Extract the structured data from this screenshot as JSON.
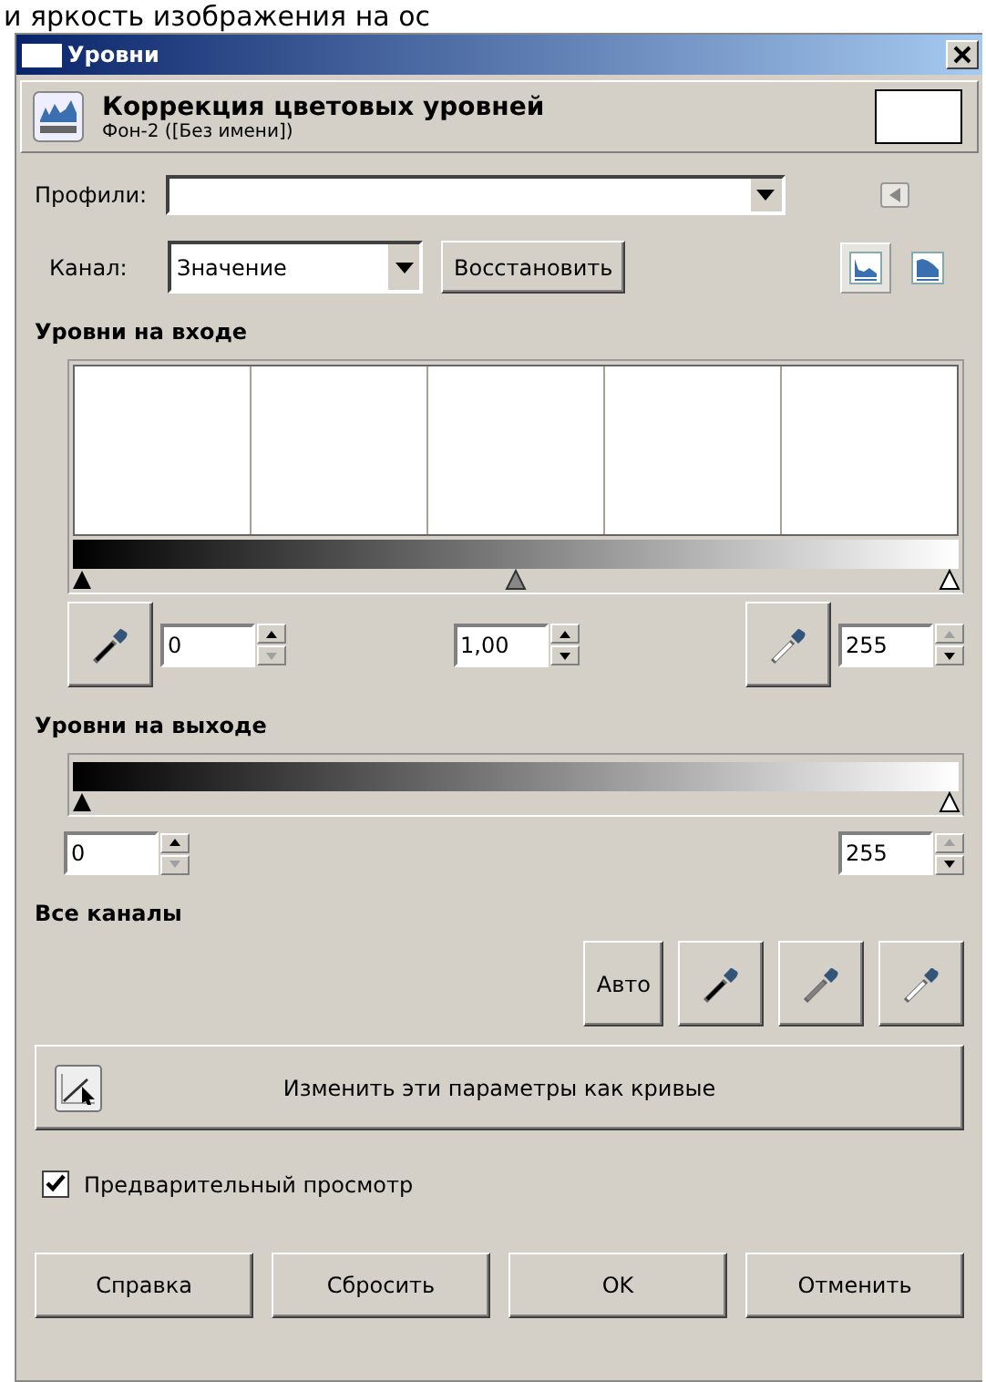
{
  "background_text": "и яркость изображения на ос",
  "window": {
    "title": "Уровни"
  },
  "header": {
    "title": "Коррекция цветовых уровней",
    "subtitle": "Фон-2 ([Без имени])"
  },
  "profiles": {
    "label": "Профили:"
  },
  "channel": {
    "label": "Канал:",
    "value": "Значение",
    "reset_button": "Восстановить"
  },
  "histogram_modes": [
    {
      "kind": "linear",
      "selected": true
    },
    {
      "kind": "log",
      "selected": false
    }
  ],
  "input_levels": {
    "heading": "Уровни на входе",
    "handles": [
      {
        "kind": "black",
        "level": 0
      },
      {
        "kind": "gray",
        "level": 0.5
      },
      {
        "kind": "white",
        "level": 1
      }
    ],
    "pickers": [
      {
        "color": "#000000"
      },
      {
        "color": "#ffffff"
      }
    ],
    "spins": [
      {
        "value": "0",
        "up_disabled": false,
        "down_disabled": true
      },
      {
        "value": "1,00",
        "up_disabled": false,
        "down_disabled": false
      },
      {
        "value": "255",
        "up_disabled": true,
        "down_disabled": false
      }
    ]
  },
  "output_levels": {
    "heading": "Уровни на выходе",
    "handles": [
      {
        "kind": "black",
        "level": 0
      },
      {
        "kind": "white",
        "level": 1
      }
    ],
    "spins": [
      {
        "value": "0",
        "up_disabled": false,
        "down_disabled": true
      },
      {
        "value": "255",
        "up_disabled": true,
        "down_disabled": false
      }
    ]
  },
  "all_channels": {
    "heading": "Все каналы",
    "auto_button": "Авто",
    "pickers": [
      {
        "color": "#000000"
      },
      {
        "color": "#808080"
      },
      {
        "color": "#ffffff"
      }
    ]
  },
  "curves_button": "Изменить эти параметры как кривые",
  "preview": {
    "label": "Предварительный просмотр",
    "checked": true
  },
  "buttons": [
    "Справка",
    "Сбросить",
    "OK",
    "Отменить"
  ]
}
